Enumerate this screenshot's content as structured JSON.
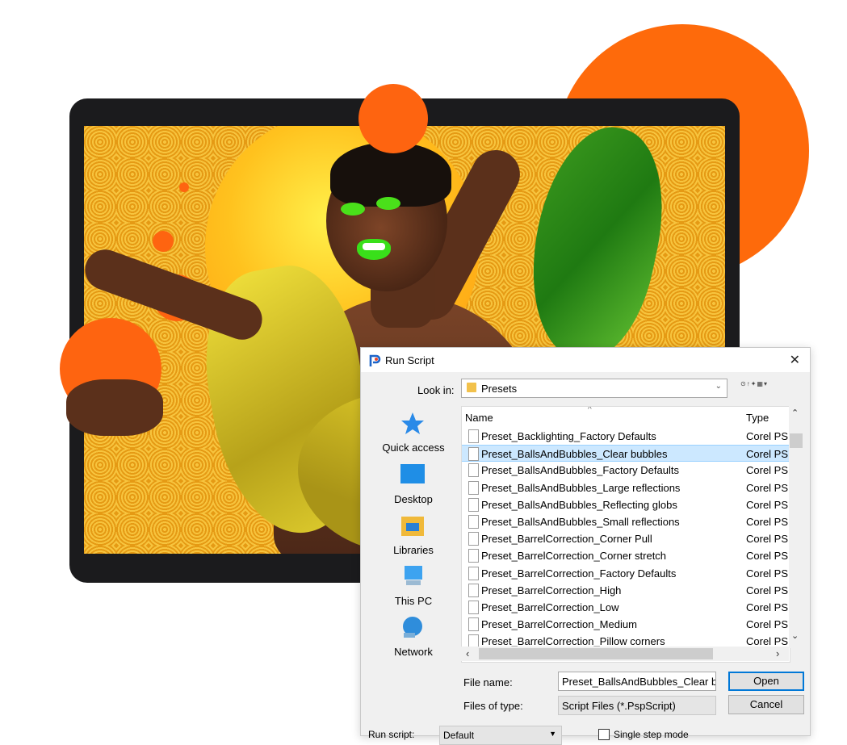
{
  "dialog": {
    "title": "Run Script",
    "close_glyph": "✕",
    "look_in_label": "Look in:",
    "look_in_value": "Presets",
    "nav_icons": [
      "back-icon",
      "up-folder-icon",
      "new-folder-icon",
      "view-menu-icon"
    ],
    "places": [
      {
        "label": "Quick access",
        "icon": "star-icon"
      },
      {
        "label": "Desktop",
        "icon": "desktop-icon"
      },
      {
        "label": "Libraries",
        "icon": "libraries-icon"
      },
      {
        "label": "This PC",
        "icon": "computer-icon"
      },
      {
        "label": "Network",
        "icon": "network-icon"
      }
    ],
    "columns": {
      "name": "Name",
      "type": "Type"
    },
    "files": [
      {
        "name": "Preset_Backlighting_Factory Defaults",
        "type": "Corel PS"
      },
      {
        "name": "Preset_BallsAndBubbles_Clear bubbles",
        "type": "Corel PS"
      },
      {
        "name": "Preset_BallsAndBubbles_Factory Defaults",
        "type": "Corel PS"
      },
      {
        "name": "Preset_BallsAndBubbles_Large reflections",
        "type": "Corel PS"
      },
      {
        "name": "Preset_BallsAndBubbles_Reflecting globs",
        "type": "Corel PS"
      },
      {
        "name": "Preset_BallsAndBubbles_Small reflections",
        "type": "Corel PS"
      },
      {
        "name": "Preset_BarrelCorrection_Corner Pull",
        "type": "Corel PS"
      },
      {
        "name": "Preset_BarrelCorrection_Corner stretch",
        "type": "Corel PS"
      },
      {
        "name": "Preset_BarrelCorrection_Factory Defaults",
        "type": "Corel PS"
      },
      {
        "name": "Preset_BarrelCorrection_High",
        "type": "Corel PS"
      },
      {
        "name": "Preset_BarrelCorrection_Low",
        "type": "Corel PS"
      },
      {
        "name": "Preset_BarrelCorrection_Medium",
        "type": "Corel PS"
      },
      {
        "name": "Preset_BarrelCorrection_Pillow corners",
        "type": "Corel PS"
      }
    ],
    "selected_index": 1,
    "file_name_label": "File name:",
    "file_name_value": "Preset_BallsAndBubbles_Clear bubbles",
    "files_of_type_label": "Files of type:",
    "files_of_type_value": "Script Files (*.PspScript)",
    "open_label": "Open",
    "cancel_label": "Cancel",
    "run_script_label": "Run script:",
    "run_script_value": "Default",
    "checkbox_label": "Single step mode"
  },
  "colors": {
    "accent_orange": "#fe6a0b",
    "selection": "#cce8ff",
    "default_button_border": "#0078d7"
  }
}
